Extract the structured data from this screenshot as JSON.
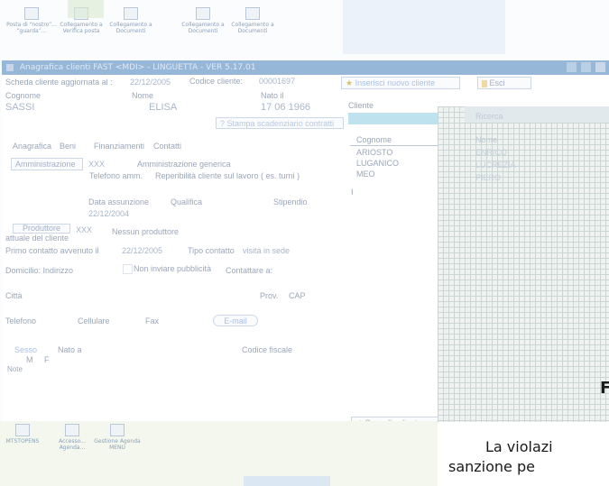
{
  "desktop": {
    "icons": [
      {
        "label": "Posta di “nostro”... \n“guarda”..."
      },
      {
        "label": "Collegamento a\nVerifica posta"
      },
      {
        "label": "Collegamento a\nDocumenti"
      },
      {
        "label": "Collegamento a\nDocumenti"
      },
      {
        "label": "Collegamento a\nDocumenti"
      }
    ],
    "bottom_icons": [
      {
        "label": "MTSTOPENS"
      },
      {
        "label": "Accesso...\nAgenda..."
      },
      {
        "label": "Gestione Agenda\nMENU"
      }
    ]
  },
  "window": {
    "title": "Anagrafica clienti FAST <MDI> - LINGUETTA - VER 5.17.01",
    "updated_label": "Scheda cliente aggiornata al :",
    "updated_value": "22/12/2005",
    "code_label": "Codice  cliente:",
    "code_value": "00001697",
    "insert_button": "Inserisci nuovo cliente",
    "exit_button": "Esci",
    "surname_label": "Cognome",
    "surname_value": "SASSI",
    "name_label": "Nome",
    "name_value": "ELISA",
    "birth_label": "Nato il",
    "birth_value": "17 06 1966",
    "print_button": "Stampa scadenziario contratti",
    "tabs": [
      "Anagrafica",
      "Beni",
      "Finanziamenti",
      "Contatti"
    ],
    "admin_button": "Amministrazione",
    "admin_xxx": "XXX",
    "admin_generic": "Amministrazione generica",
    "admin_phone": "Telefono amm.",
    "reachability": "Reperibilità cliente sul lavoro ( es. turni )",
    "hire_label": "Data  assunzione",
    "hire_value": "22/12/2004",
    "qualifica_label": "Qualifica",
    "stipendio_label": "Stipendio",
    "producer_button": "Produttore",
    "producer_caption": "attuale del cliente",
    "producer_xxx": "XXX",
    "producer_value": "Nessun produttore",
    "first_contact_label": "Primo contatto avvenuto il",
    "first_contact_value": "22/12/2005",
    "contact_type_label": "Tipo contatto",
    "contact_type_value": "visita in sede",
    "domicile_label": "Domicilio: Indirizzo",
    "no_ads_label": "Non inviare pubblicità",
    "contact_at_label": "Contattare a:",
    "city_label": "Città",
    "prov_label": "Prov.",
    "cap_label": "CAP",
    "phone_label": "Telefono",
    "mobile_label": "Cellulare",
    "fax_label": "Fax",
    "email_button": "E-mail",
    "sex_label": "Sesso",
    "sex_m": "M",
    "sex_f": "F",
    "born_at_label": "Nato a",
    "tax_code_label": "Codice fiscale",
    "notes_label": "Note",
    "client_label": "Cliente",
    "list_header": "Cognome",
    "list_items": [
      "ARIOSTO",
      "LUGANICO",
      "MEO",
      "I"
    ],
    "delete_button": "Cancella cliente"
  },
  "overlay": {
    "col_headers": [
      "Ricerca",
      "Nome"
    ],
    "rows": [
      "ENRICO",
      "LUCREZIA",
      "PIERO"
    ],
    "big_letter": "F",
    "line1": "La violazi",
    "line2": "sanzione pe"
  },
  "colors": {
    "titlebar": "#97b7d8",
    "overlay_grid": "#eef3f2"
  }
}
